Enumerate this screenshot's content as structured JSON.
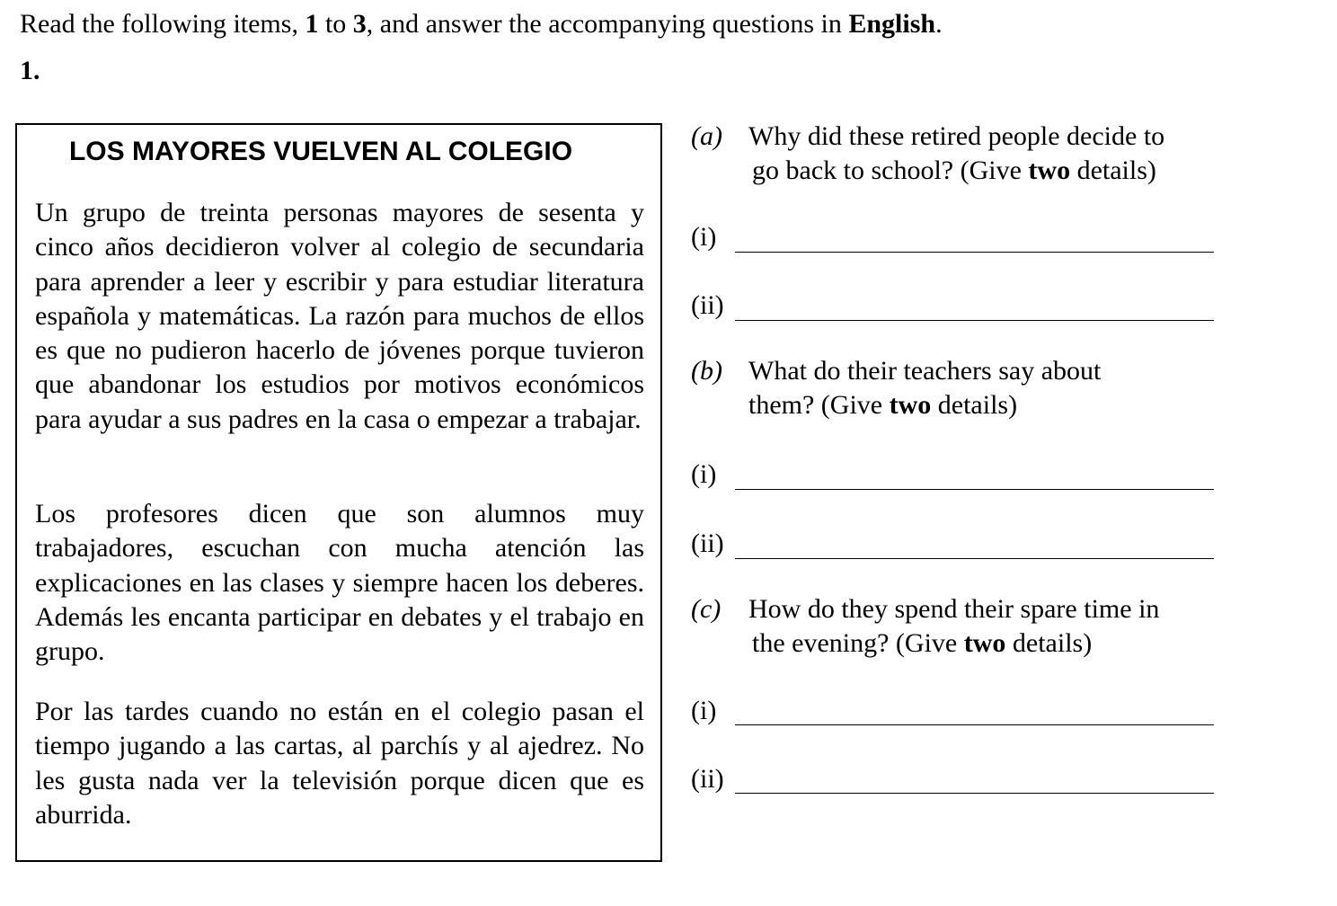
{
  "instructions": {
    "pre": "Read the following items, ",
    "n1": "1",
    "mid": " to ",
    "n2": "3",
    "post": ", and answer the accompanying questions in ",
    "lang": "English",
    "end": "."
  },
  "item_number": "1.",
  "passage": {
    "title": "LOS MAYORES VUELVEN AL COLEGIO",
    "paragraphs": [
      "Un grupo de treinta personas mayores de sesenta y cinco años decidieron volver al colegio de secundaria para aprender a leer y escribir y para estudiar literatura española y matemáticas. La razón para muchos de ellos es que no pudieron hacerlo de jóvenes porque tuvieron que abandonar los estudios por motivos económicos para ayudar a sus padres en la casa o empezar a trabajar.",
      "Los profesores dicen que son alumnos muy trabajadores, escuchan con mucha atención las explicaciones en las clases y siempre hacen los deberes. Además les encanta participar en debates y el trabajo en grupo.",
      "Por las tardes cuando no están en el colegio pasan el tiempo jugando a las cartas, al parchís y al ajedrez. No les gusta nada ver la televisión porque dicen que es aburrida."
    ]
  },
  "questions": [
    {
      "label": "(a)",
      "line1": "Why did these retired people decide to",
      "line2_pre": "go back to school? (Give ",
      "line2_bold": "two",
      "line2_post": " details)",
      "answers": [
        "(i)",
        "(ii)"
      ]
    },
    {
      "label": "(b)",
      "line1": "What do their teachers say about",
      "line2_pre": "them? (Give ",
      "line2_bold": "two",
      "line2_post": " details)",
      "answers": [
        "(i)",
        "(ii)"
      ]
    },
    {
      "label": "(c)",
      "line1": "How do they spend their spare time in",
      "line2_pre": "the evening?  (Give ",
      "line2_bold": "two",
      "line2_post": " details)",
      "answers": [
        "(i)",
        "(ii)"
      ]
    }
  ]
}
